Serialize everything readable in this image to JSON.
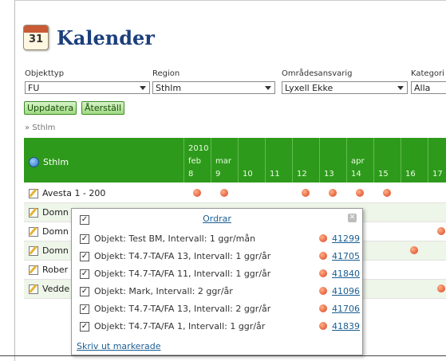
{
  "title": "Kalender",
  "calendar_icon_number": "31",
  "filters": {
    "objekttyp": {
      "label": "Objekttyp",
      "value": "FU"
    },
    "region": {
      "label": "Region",
      "value": "Sthlm"
    },
    "omradesansvarig": {
      "label": "Områdesansvarig",
      "value": "Lyxell Ekke"
    },
    "kategori": {
      "label": "Kategori",
      "value": "Alla"
    }
  },
  "buttons": {
    "update": "Uppdatera",
    "reset": "Återställ"
  },
  "breadcrumb": "» Sthlm",
  "grid": {
    "region": "Sthlm",
    "columns": [
      {
        "year": "2010",
        "month": "feb",
        "week": "8"
      },
      {
        "year": "",
        "month": "mar",
        "week": "9"
      },
      {
        "year": "",
        "month": "",
        "week": "10"
      },
      {
        "year": "",
        "month": "",
        "week": "11"
      },
      {
        "year": "",
        "month": "",
        "week": "12"
      },
      {
        "year": "",
        "month": "",
        "week": "13"
      },
      {
        "year": "",
        "month": "apr",
        "week": "14"
      },
      {
        "year": "",
        "month": "",
        "week": "15"
      },
      {
        "year": "",
        "month": "",
        "week": "16"
      },
      {
        "year": "",
        "month": "",
        "week": "17"
      }
    ],
    "rows": [
      {
        "name": "Avesta 1 - 200"
      },
      {
        "name": "Domn"
      },
      {
        "name": "Domn"
      },
      {
        "name": "Domn"
      },
      {
        "name": "Rober"
      },
      {
        "name": "Vedde"
      }
    ]
  },
  "popup": {
    "header": "Ordrar",
    "items": [
      {
        "text": "Objekt: Test BM, Intervall: 1 ggr/mån",
        "order": "41299"
      },
      {
        "text": "Objekt: T4.7-TA/FA 13, Intervall: 1 ggr/år",
        "order": "41705"
      },
      {
        "text": "Objekt: T4.7-TA/FA 11, Intervall: 1 ggr/år",
        "order": "41840"
      },
      {
        "text": "Objekt: Mark, Intervall: 2 ggr/år",
        "order": "41096"
      },
      {
        "text": "Objekt: T4.7-TA/FA 13, Intervall: 2 ggr/år",
        "order": "41706"
      },
      {
        "text": "Objekt: T4.7-TA/FA 1, Intervall: 1 ggr/år",
        "order": "41839"
      }
    ],
    "print_link": "Skriv ut markerade"
  }
}
